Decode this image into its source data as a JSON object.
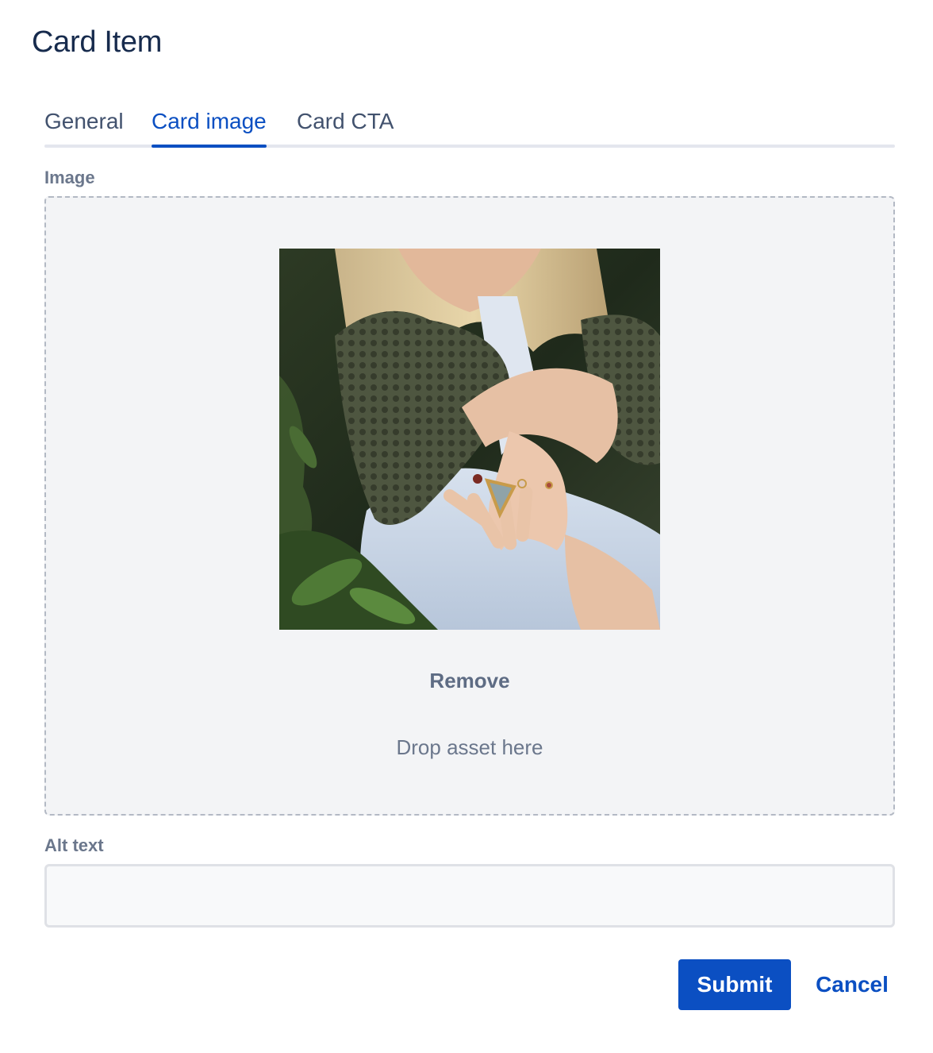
{
  "dialog": {
    "title": "Card Item"
  },
  "tabs": [
    {
      "label": "General",
      "active": false
    },
    {
      "label": "Card image",
      "active": true
    },
    {
      "label": "Card CTA",
      "active": false
    }
  ],
  "image_field": {
    "label": "Image",
    "remove_label": "Remove",
    "drop_hint": "Drop asset here"
  },
  "alt_text_field": {
    "label": "Alt text",
    "value": ""
  },
  "actions": {
    "submit_label": "Submit",
    "cancel_label": "Cancel"
  },
  "colors": {
    "accent": "#0b4fc2",
    "title_text": "#172b4d",
    "muted_text": "#6b778c",
    "dropzone_bg": "#f3f4f6"
  }
}
